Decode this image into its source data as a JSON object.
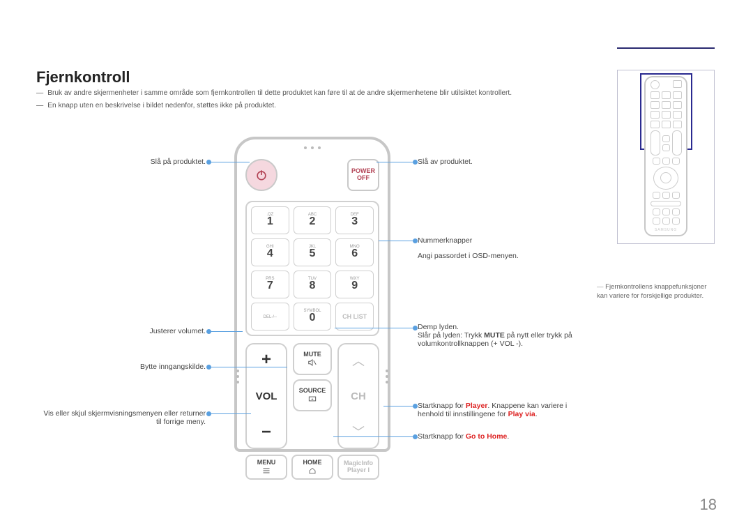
{
  "page": {
    "number": "18"
  },
  "title": "Fjernkontroll",
  "notes": {
    "n1": "Bruk av andre skjermenheter i samme område som fjernkontrollen til dette produktet kan føre til at de andre skjermenhetene blir utilsiktet kontrollert.",
    "n2": "En knapp uten en beskrivelse i bildet nedenfor, støttes ikke på produktet."
  },
  "remote": {
    "power_off_top": "POWER",
    "power_off_bottom": "OFF",
    "keys": [
      {
        "alpha": ".QZ",
        "digit": "1"
      },
      {
        "alpha": "ABC",
        "digit": "2"
      },
      {
        "alpha": "DEF",
        "digit": "3"
      },
      {
        "alpha": "GHI",
        "digit": "4"
      },
      {
        "alpha": "JKL",
        "digit": "5"
      },
      {
        "alpha": "MNO",
        "digit": "6"
      },
      {
        "alpha": "PRS",
        "digit": "7"
      },
      {
        "alpha": "TUV",
        "digit": "8"
      },
      {
        "alpha": "WXY",
        "digit": "9"
      },
      {
        "alpha": "DEL-/--",
        "digit": ""
      },
      {
        "alpha": "SYMBOL",
        "digit": "0"
      },
      {
        "alpha": "",
        "digit": "CH LIST"
      }
    ],
    "vol_label": "VOL",
    "ch_label": "CH",
    "mute": "MUTE",
    "source": "SOURCE",
    "menu": "MENU",
    "home": "HOME",
    "magic_top": "MagicInfo",
    "magic_bottom": "Player I"
  },
  "left_callouts": {
    "c1": "Slå på produktet.",
    "c2": "Justerer volumet.",
    "c3": "Bytte inngangskilde.",
    "c4a": "Vis eller skjul skjermvisningsmenyen eller returner",
    "c4b": "til forrige meny."
  },
  "right_callouts": {
    "c1": "Slå av produktet.",
    "c2a": "Nummerknapper",
    "c2b": "Angi passordet i OSD-menyen.",
    "c3a": "Demp lyden.",
    "c3b_pre": "Slår på lyden: Trykk ",
    "c3b_bold": "MUTE",
    "c3b_post": " på nytt eller trykk på",
    "c3c": "volumkontrollknappen (+ VOL -).",
    "c4a_pre": "Startknapp for ",
    "c4a_red": "Player",
    "c4a_post": ". Knappene kan variere i",
    "c4b_pre": "henhold til innstillingene for ",
    "c4b_red": "Play via",
    "c4b_post": ".",
    "c5_pre": "Startknapp for ",
    "c5_red": "Go to Home",
    "c5_post": "."
  },
  "footnote": "Fjernkontrollens knappefunksjoner kan variere for forskjellige produkter.",
  "mini": {
    "brand": "SAMSUNG"
  }
}
